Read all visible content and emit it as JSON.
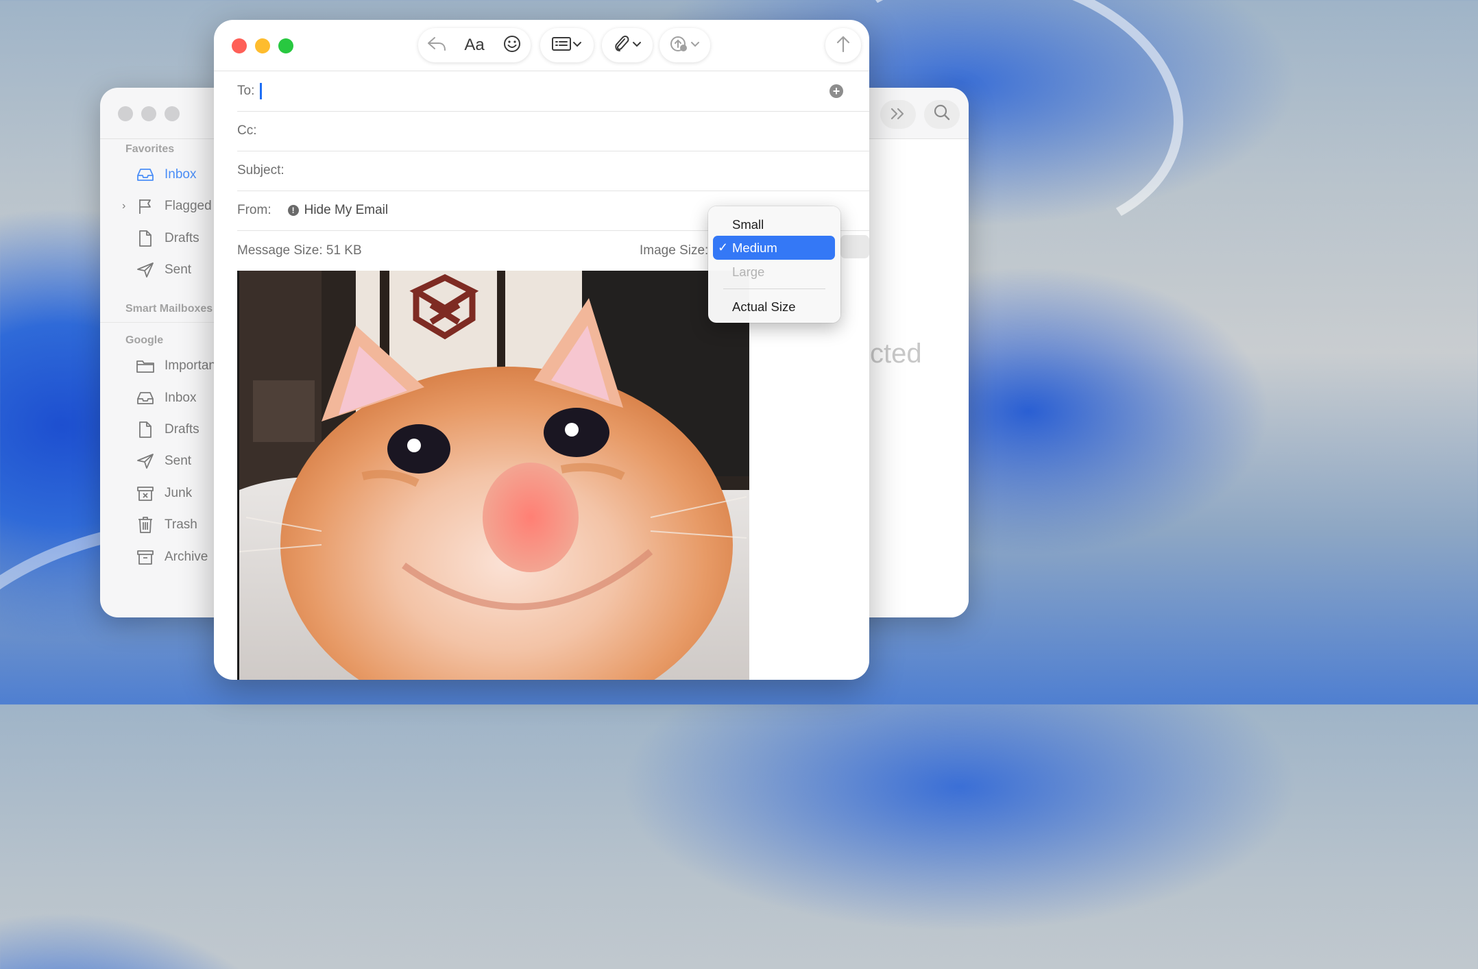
{
  "colors": {
    "accent": "#3478f6",
    "close": "#fe5f57",
    "minimize": "#febc2e",
    "zoom": "#28c840"
  },
  "sidebar": {
    "favorites_heading": "Favorites",
    "favorites": [
      {
        "label": "Inbox",
        "icon": "inbox-icon",
        "active": true
      },
      {
        "label": "Flagged",
        "icon": "flag-icon"
      },
      {
        "label": "Drafts",
        "icon": "document-icon"
      },
      {
        "label": "Sent",
        "icon": "paper-plane-icon"
      }
    ],
    "smart_heading": "Smart Mailboxes",
    "google_heading": "Google",
    "google": [
      {
        "label": "Important",
        "icon": "folder-icon"
      },
      {
        "label": "Inbox",
        "icon": "inbox-icon"
      },
      {
        "label": "Drafts",
        "icon": "document-icon"
      },
      {
        "label": "Sent",
        "icon": "paper-plane-icon"
      },
      {
        "label": "Junk",
        "icon": "junk-icon"
      },
      {
        "label": "Trash",
        "icon": "trash-icon"
      },
      {
        "label": "Archive",
        "icon": "archive-icon"
      }
    ]
  },
  "back_window": {
    "no_selection_fragment": "cted"
  },
  "toolbar": {
    "format_label": "Aa"
  },
  "compose": {
    "to_label": "To:",
    "cc_label": "Cc:",
    "subject_label": "Subject:",
    "from_label": "From:",
    "from_value": "Hide My Email",
    "message_size": "Message Size: 51 KB",
    "image_size_label": "Image Size:"
  },
  "image_size_menu": {
    "options": [
      "Small",
      "Medium",
      "Large",
      "Actual Size"
    ],
    "selected": "Medium",
    "disabled": "Large",
    "checkmark": "✓"
  }
}
